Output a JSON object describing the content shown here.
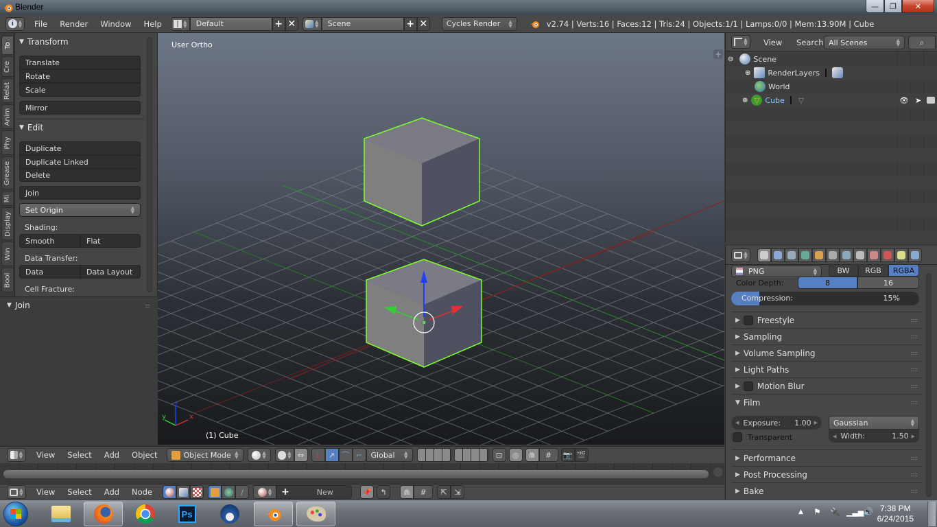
{
  "window": {
    "title": "Blender",
    "buttons": {
      "minimize": "—",
      "restore": "❐",
      "close": "✕"
    }
  },
  "info_header": {
    "menus": [
      "File",
      "Render",
      "Window",
      "Help"
    ],
    "screen_layout": "Default",
    "scene": "Scene",
    "render_engine": "Cycles Render",
    "stats": "v2.74 | Verts:16 | Faces:12 | Tris:24 | Objects:1/1 | Lamps:0/0 | Mem:13.90M | Cube"
  },
  "tool_tabs": [
    "To",
    "Cre",
    "Relat",
    "Anim",
    "Phy",
    "Grease",
    "Mi",
    "Display",
    "Win",
    "Bool"
  ],
  "tool_shelf": {
    "transform": {
      "title": "Transform",
      "buttons": [
        "Translate",
        "Rotate",
        "Scale"
      ],
      "mirror": "Mirror"
    },
    "edit": {
      "title": "Edit",
      "buttons": [
        "Duplicate",
        "Duplicate Linked",
        "Delete"
      ],
      "join": "Join",
      "set_origin": "Set Origin",
      "shading_label": "Shading:",
      "shading": [
        "Smooth",
        "Flat"
      ],
      "data_transfer_label": "Data Transfer:",
      "data_transfer": [
        "Data",
        "Data Layout"
      ],
      "cell_fracture_label": "Cell Fracture:"
    },
    "operator_panel": "Join"
  },
  "viewport": {
    "view_name": "User Ortho",
    "object_info": "(1) Cube",
    "axis_labels": {
      "x": "x",
      "y": "y",
      "z": "z"
    },
    "colors": {
      "selection": "#7fff2a",
      "x_axis": "#e03030",
      "y_axis": "#30d030",
      "z_axis": "#2040ff"
    }
  },
  "outliner": {
    "menus": [
      "View",
      "Search"
    ],
    "display_mode": "All Scenes",
    "tree": [
      {
        "label": "Scene",
        "level": 0
      },
      {
        "label": "RenderLayers",
        "level": 1
      },
      {
        "label": "World",
        "level": 1
      },
      {
        "label": "Cube",
        "level": 1,
        "selected": true
      }
    ]
  },
  "properties": {
    "format": "PNG",
    "color_modes": [
      "BW",
      "RGB",
      "RGBA"
    ],
    "color_mode_active": "RGBA",
    "color_depth_label": "Color Depth:",
    "color_depths": [
      "8",
      "16"
    ],
    "color_depth_active": "8",
    "compression_label": "Compression:",
    "compression_value": "15%",
    "compression_fraction": 0.15,
    "panels": [
      "Freestyle",
      "Sampling",
      "Volume Sampling",
      "Light Paths",
      "Motion Blur"
    ],
    "film": {
      "title": "Film",
      "exposure_label": "Exposure:",
      "exposure_value": "1.00",
      "filter": "Gaussian",
      "width_label": "Width:",
      "width_value": "1.50",
      "transparent_label": "Transparent"
    },
    "panels_after": [
      "Performance",
      "Post Processing",
      "Bake"
    ]
  },
  "view3d_header": {
    "menus": [
      "View",
      "Select",
      "Add",
      "Object"
    ],
    "mode": "Object Mode",
    "orientation": "Global"
  },
  "node_header": {
    "menus": [
      "View",
      "Select",
      "Add",
      "Node"
    ],
    "new_label": "New"
  },
  "taskbar": {
    "apps": [
      "Start",
      "Windows Explorer",
      "Firefox",
      "Chrome",
      "Photoshop",
      "Thunderbird",
      "Blender",
      "Paint"
    ],
    "time": "7:38 PM",
    "date": "6/24/2015"
  }
}
